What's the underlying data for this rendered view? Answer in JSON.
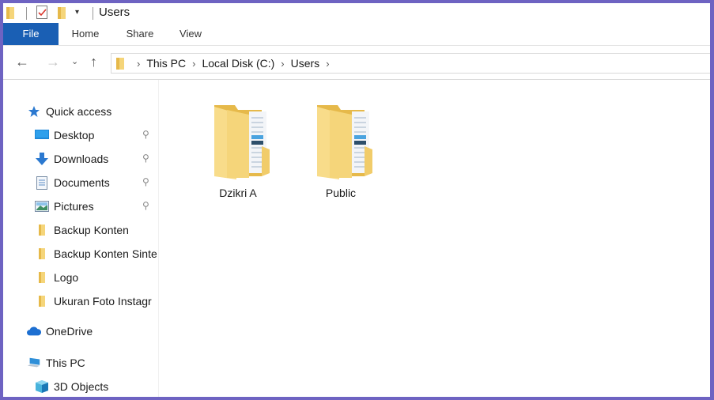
{
  "window": {
    "title": "Users",
    "colors": {
      "frame": "#6e63c2",
      "file_tab": "#1a5fb4",
      "folder": "#f5d57a",
      "folder_dark": "#e6b94a"
    }
  },
  "quick_access_toolbar": {
    "icons": [
      "folder-icon",
      "properties-check-icon",
      "new-folder-icon",
      "customize-dropdown-icon"
    ]
  },
  "ribbon": {
    "tabs": [
      {
        "label": "File",
        "active": true
      },
      {
        "label": "Home"
      },
      {
        "label": "Share"
      },
      {
        "label": "View"
      }
    ]
  },
  "navigation": {
    "back_icon": "←",
    "forward_icon": "→",
    "recent_icon": "⌄",
    "up_icon": "↑",
    "breadcrumb": [
      "This PC",
      "Local Disk (C:)",
      "Users"
    ],
    "separator": "›"
  },
  "sidebar": {
    "quick_access": {
      "label": "Quick access",
      "icon": "star-icon"
    },
    "pinned": [
      {
        "label": "Desktop",
        "icon": "desktop-icon",
        "pinned": true
      },
      {
        "label": "Downloads",
        "icon": "download-icon",
        "pinned": true
      },
      {
        "label": "Documents",
        "icon": "documents-icon",
        "pinned": true
      },
      {
        "label": "Pictures",
        "icon": "pictures-icon",
        "pinned": true
      }
    ],
    "folders": [
      {
        "label": "Backup Konten"
      },
      {
        "label": "Backup Konten Sinte"
      },
      {
        "label": "Logo"
      },
      {
        "label": "Ukuran Foto Instagr"
      }
    ],
    "onedrive": {
      "label": "OneDrive",
      "icon": "cloud-icon"
    },
    "this_pc": {
      "label": "This PC",
      "icon": "computer-icon"
    },
    "objects3d": {
      "label": "3D Objects",
      "icon": "cube-icon"
    },
    "pin_glyph": "📌"
  },
  "content": {
    "items": [
      {
        "name": "Dzikri A",
        "type": "folder"
      },
      {
        "name": "Public",
        "type": "folder"
      }
    ]
  }
}
